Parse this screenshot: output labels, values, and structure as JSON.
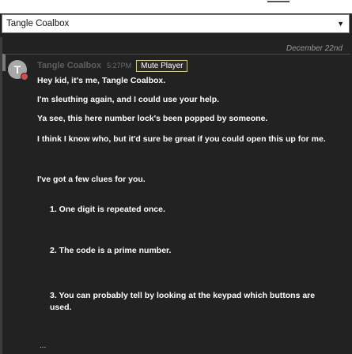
{
  "chat_selector": {
    "value": "Tangle Coalbox",
    "caret": "▼"
  },
  "date_divider": "December 22nd",
  "message": {
    "avatar_letter": "T",
    "username": "Tangle Coalbox",
    "timestamp": "5:27PM",
    "mute_button": "Mute Player",
    "lines": [
      "Hey kid, it's me, Tangle Coalbox.",
      "I'm sleuthing again, and I could use your help.",
      "Ya see, this here number lock's been popped by someone.",
      "I think I know who, but it'd sure be great if you could open this up for me.",
      "I've got a few clues for you."
    ],
    "clues": [
      "1. One digit is repeated once.",
      "2. The code is a prime number.",
      "3. You can probably tell by looking at the keypad which buttons are used."
    ],
    "ellipsis": "..."
  },
  "colors": {
    "background": "#222222",
    "mute_border": "#d8d14a",
    "status_dot": "#d44b4b",
    "avatar": "#a8a8a8"
  }
}
